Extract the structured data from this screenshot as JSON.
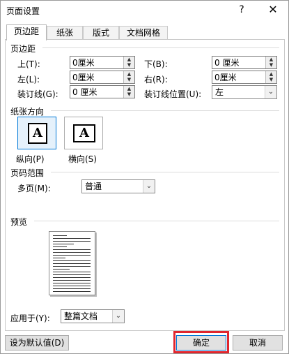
{
  "dialog": {
    "title": "页面设置",
    "help_label": "?",
    "close_label": "✕"
  },
  "tabs": [
    {
      "label": "页边距",
      "active": true
    },
    {
      "label": "纸张",
      "active": false
    },
    {
      "label": "版式",
      "active": false
    },
    {
      "label": "文档网格",
      "active": false
    }
  ],
  "margins": {
    "section_title": "页边距",
    "top": {
      "label": "上(T):",
      "value": "0厘米"
    },
    "bottom": {
      "label": "下(B):",
      "value": "0 厘米"
    },
    "left": {
      "label": "左(L):",
      "value": "0厘米"
    },
    "right": {
      "label": "右(R):",
      "value": "0厘米"
    },
    "gutter": {
      "label": "装订线(G):",
      "value": "0 厘米"
    },
    "gutter_position": {
      "label": "装订线位置(U):",
      "value": "左"
    }
  },
  "orientation": {
    "section_title": "纸张方向",
    "portrait": {
      "label": "纵向(P)",
      "glyph": "A",
      "selected": true
    },
    "landscape": {
      "label": "横向(S)",
      "glyph": "A",
      "selected": false
    }
  },
  "pages": {
    "section_title": "页码范围",
    "multiple_label": "多页(M):",
    "multiple_value": "普通"
  },
  "preview": {
    "section_title": "预览",
    "apply_label": "应用于(Y):",
    "apply_value": "整篇文档"
  },
  "buttons": {
    "set_default": "设为默认值(D)",
    "ok": "确定",
    "cancel": "取消"
  },
  "colors": {
    "accent": "#0078d7",
    "highlight": "#e0262e"
  },
  "icons": {
    "spinner_up": "▲",
    "spinner_down": "▼",
    "dropdown": "⌄"
  }
}
